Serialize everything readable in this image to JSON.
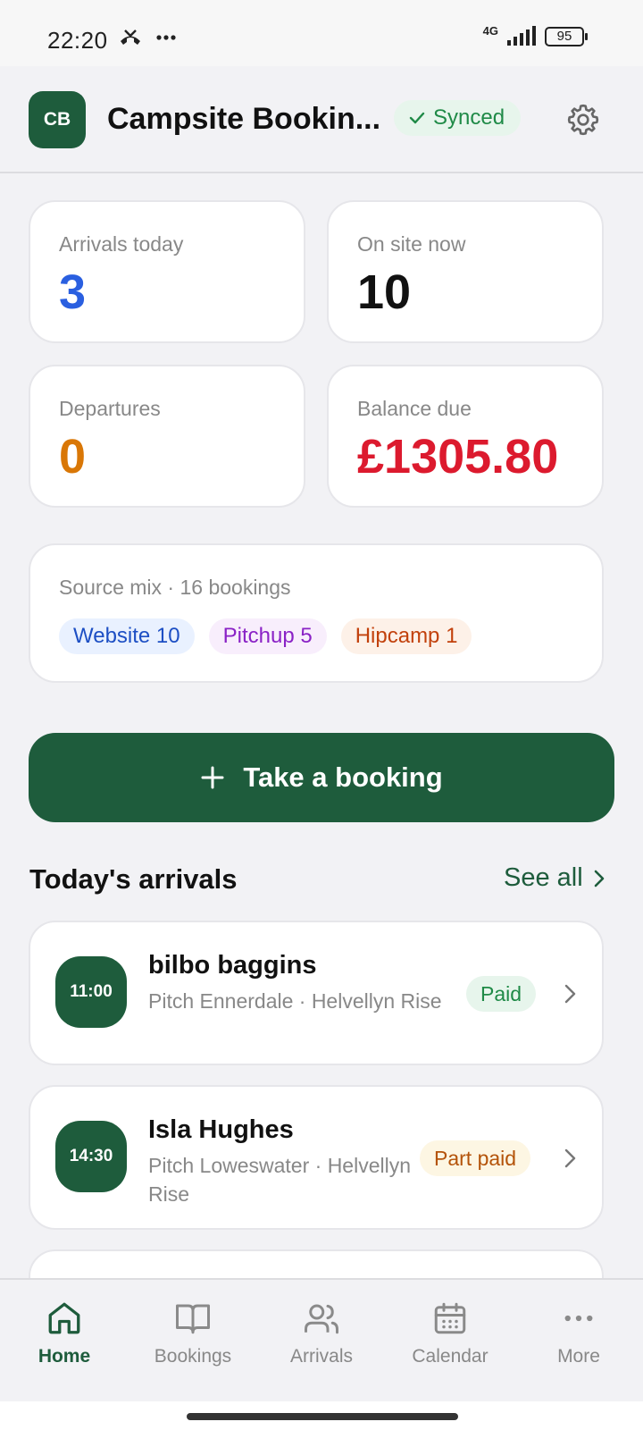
{
  "status_bar": {
    "time": "22:20",
    "network": "4G",
    "battery": "95"
  },
  "header": {
    "logo_initials": "CB",
    "title": "Campsite Bookin...",
    "sync_status": "Synced"
  },
  "stats": [
    {
      "label": "Arrivals today",
      "value": "3",
      "color": "#2a5fe0"
    },
    {
      "label": "On site now",
      "value": "10",
      "color": "#111111"
    },
    {
      "label": "Departures",
      "value": "0",
      "color": "#d97706"
    },
    {
      "label": "Balance due",
      "value": "£1305.80",
      "color": "#dc1a2e"
    }
  ],
  "source_mix": {
    "label": "Source mix · 16 bookings",
    "chips": [
      "Website 10",
      "Pitchup 5",
      "Hipcamp 1"
    ]
  },
  "cta": {
    "label": "Take a booking"
  },
  "arrivals": {
    "title": "Today's arrivals",
    "see_all": "See all",
    "items": [
      {
        "time": "11:00",
        "name": "bilbo baggins",
        "meta": "Pitch Ennerdale · Helvellyn Rise",
        "status": "Paid"
      },
      {
        "time": "14:30",
        "name": "Isla Hughes",
        "meta": "Pitch Loweswater · Helvellyn Rise",
        "status": "Part paid"
      }
    ]
  },
  "tabs": [
    {
      "label": "Home",
      "icon": "home-icon",
      "active": true
    },
    {
      "label": "Bookings",
      "icon": "book-icon",
      "active": false
    },
    {
      "label": "Arrivals",
      "icon": "users-icon",
      "active": false
    },
    {
      "label": "Calendar",
      "icon": "calendar-icon",
      "active": false
    },
    {
      "label": "More",
      "icon": "more-icon",
      "active": false
    }
  ],
  "colors": {
    "brand": "#1e5c3c",
    "paid": "#1f8a47",
    "part_paid": "#b45309"
  }
}
